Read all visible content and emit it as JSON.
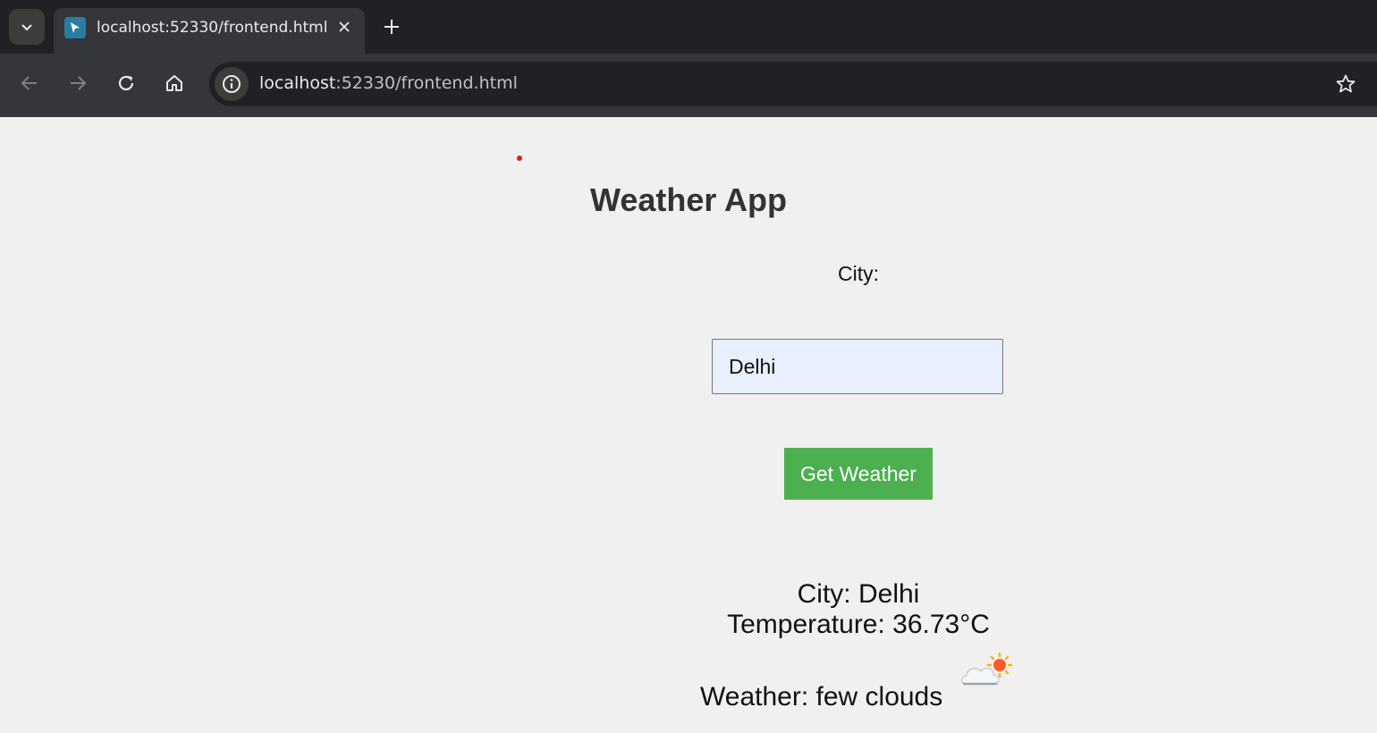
{
  "browser": {
    "tab_title": "localhost:52330/frontend.html",
    "url_host": "localhost",
    "url_rest": ":52330/frontend.html",
    "icons": {
      "tab_search": "chevron-down-icon",
      "favicon": "cursor-favicon-icon",
      "close": "close-icon",
      "new_tab": "plus-icon",
      "back": "arrow-left-icon",
      "forward": "arrow-right-icon",
      "reload": "reload-icon",
      "home": "home-icon",
      "site_info": "info-icon",
      "bookmark": "star-icon"
    }
  },
  "app": {
    "title": "Weather App",
    "city_label": "City:",
    "city_input_value": "Delhi",
    "button_label": "Get Weather",
    "result_city": "City: Delhi",
    "result_temperature": "Temperature: 36.73°C",
    "result_weather": "Weather: few clouds",
    "weather_icon": "few-clouds-icon",
    "colors": {
      "button_bg": "#4caf50",
      "input_bg": "#e8f0fe",
      "page_bg": "#f0f0f0"
    }
  }
}
